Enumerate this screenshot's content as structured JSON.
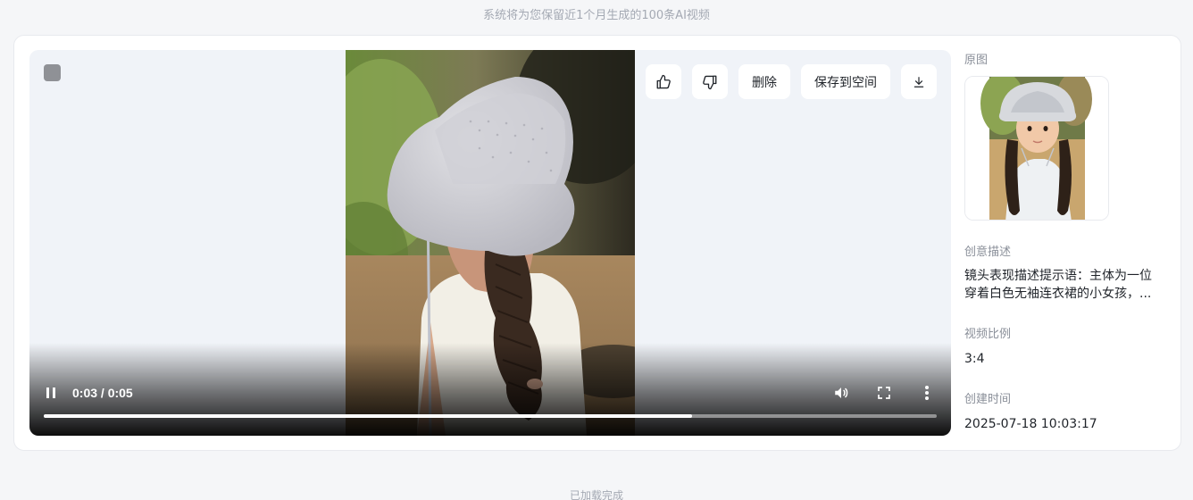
{
  "notice": "系统将为您保留近1个月生成的100条AI视频",
  "footer": "已加载完成",
  "player": {
    "time": "0:03 / 0:05",
    "progress_fraction": 0.726,
    "actions": {
      "like_icon": "thumbs-up-icon",
      "dislike_icon": "thumbs-down-icon",
      "delete_label": "删除",
      "save_label": "保存到空间",
      "download_icon": "download-icon"
    }
  },
  "sidebar": {
    "original_label": "原图",
    "description_label": "创意描述",
    "description_text": "镜头表现描述提示语：主体为一位穿着白色无袖连衣裙的小女孩，...",
    "ratio_label": "视频比例",
    "ratio_value": "3:4",
    "created_label": "创建时间",
    "created_value": "2025-07-18 10:03:17"
  },
  "colors": {
    "page_bg": "#f5f6f8",
    "player_bg": "#f0f3f8",
    "muted_text": "#8a8f99"
  }
}
